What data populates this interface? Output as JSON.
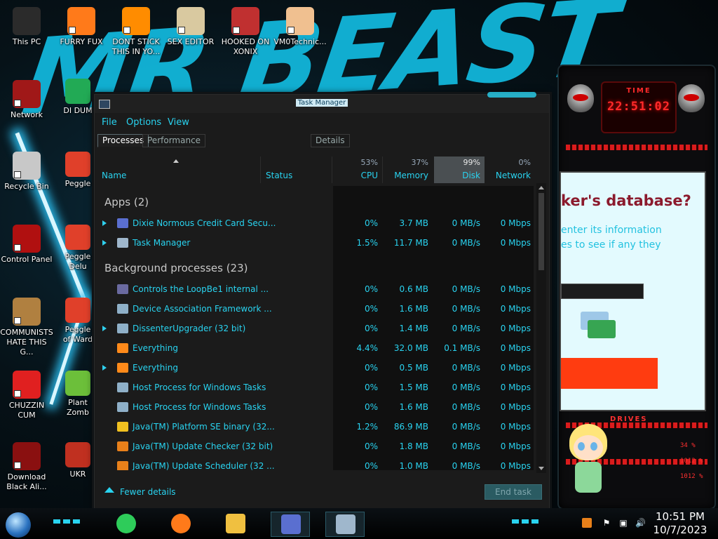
{
  "desktop": {
    "wallpaper_text": "MR BEAST",
    "icons": [
      {
        "label": "This PC",
        "icon": "computer-icon",
        "color": "#2b2b2b"
      },
      {
        "label": "FURRY FUX",
        "icon": "firefox-icon",
        "color": "#ff7a1a"
      },
      {
        "label": "DONT STICK THIS IN YO...",
        "icon": "vlc-cone-icon",
        "color": "#ff8c00"
      },
      {
        "label": "SEX EDITOR",
        "icon": "hxd-editor-icon",
        "color": "#d9c9a0"
      },
      {
        "label": "HOOKED ON XONIX",
        "icon": "xonix-game-icon",
        "color": "#c03030"
      },
      {
        "label": "VM0Technic...",
        "icon": "doctor-avatar-icon",
        "color": "#f0c090"
      },
      {
        "label": "Network",
        "icon": "network-icon",
        "color": "#a01818"
      },
      {
        "label": "Recycle Bin",
        "icon": "recycle-bin-icon",
        "color": "#c8c8c8"
      },
      {
        "label": "Control Panel",
        "icon": "control-panel-icon",
        "color": "#b01010"
      },
      {
        "label": "COMMUNISTS HATE THIS G...",
        "icon": "money-bag-icon",
        "color": "#b08040"
      },
      {
        "label": "CHUZZIN CUM",
        "icon": "chuzzle-icon",
        "color": "#e02020"
      },
      {
        "label": "Download Black Ali...",
        "icon": "alien-download-icon",
        "color": "#8a1010"
      }
    ],
    "partial_icons": [
      {
        "label": "DI DUM",
        "icon": "app-green-icon",
        "color": "#22aa55"
      },
      {
        "label": "Peggle",
        "icon": "peggle-icon",
        "color": "#e0402a"
      },
      {
        "label": "Peggle Delu",
        "icon": "peggle-deluxe-icon",
        "color": "#e0402a"
      },
      {
        "label": "Peggle of Ward",
        "icon": "peggle-nights-icon",
        "color": "#e0402a"
      },
      {
        "label": "Plant Zomb",
        "icon": "plants-zombies-icon",
        "color": "#6cbf3a"
      },
      {
        "label": "UKR",
        "icon": "app-red-icon",
        "color": "#c03020"
      }
    ]
  },
  "gadget": {
    "time_label": "TIME",
    "time": "22:51:02",
    "drives_label": "DRIVES",
    "drive_values": [
      "34 %",
      "1012 %",
      "1012 %"
    ],
    "browser_heading": "ker's database?",
    "browser_line1": "enter its information",
    "browser_line2": "es to see if any they"
  },
  "taskmanager": {
    "title": "Task Manager",
    "menu": [
      "File",
      "Options",
      "View"
    ],
    "tabs": [
      "Processes",
      "Performance",
      "Details"
    ],
    "columns": {
      "name": "Name",
      "status": "Status",
      "cpu_pct": "53%",
      "cpu": "CPU",
      "mem_pct": "37%",
      "mem": "Memory",
      "disk_pct": "99%",
      "disk": "Disk",
      "net_pct": "0%",
      "net": "Network"
    },
    "apps_group": "Apps (2)",
    "apps": [
      {
        "name": "Dixie Normous Credit Card Secu...",
        "cpu": "0%",
        "mem": "3.7 MB",
        "disk": "0 MB/s",
        "net": "0 Mbps",
        "icon": "credit-card-app-icon",
        "color": "#5a6fd0",
        "expand": true
      },
      {
        "name": "Task Manager",
        "cpu": "1.5%",
        "mem": "11.7 MB",
        "disk": "0 MB/s",
        "net": "0 Mbps",
        "icon": "task-manager-icon",
        "color": "#9fb7cc",
        "expand": true
      }
    ],
    "bg_group": "Background processes (23)",
    "background": [
      {
        "name": "Controls the LoopBe1 internal ...",
        "cpu": "0%",
        "mem": "0.6 MB",
        "disk": "0 MB/s",
        "net": "0 Mbps",
        "icon": "loopbe-icon",
        "color": "#6a6aa0",
        "expand": false
      },
      {
        "name": "Device Association Framework ...",
        "cpu": "0%",
        "mem": "1.6 MB",
        "disk": "0 MB/s",
        "net": "0 Mbps",
        "icon": "service-window-icon",
        "color": "#8fb0c8",
        "expand": false
      },
      {
        "name": "DissenterUpgrader (32 bit)",
        "cpu": "0%",
        "mem": "1.4 MB",
        "disk": "0 MB/s",
        "net": "0 Mbps",
        "icon": "service-window-icon",
        "color": "#8fb0c8",
        "expand": true
      },
      {
        "name": "Everything",
        "cpu": "4.4%",
        "mem": "32.0 MB",
        "disk": "0.1 MB/s",
        "net": "0 Mbps",
        "icon": "magnifier-icon",
        "color": "#ff8a1a",
        "expand": false
      },
      {
        "name": "Everything",
        "cpu": "0%",
        "mem": "0.5 MB",
        "disk": "0 MB/s",
        "net": "0 Mbps",
        "icon": "magnifier-icon",
        "color": "#ff8a1a",
        "expand": true
      },
      {
        "name": "Host Process for Windows Tasks",
        "cpu": "0%",
        "mem": "1.5 MB",
        "disk": "0 MB/s",
        "net": "0 Mbps",
        "icon": "service-window-icon",
        "color": "#8fb0c8",
        "expand": false
      },
      {
        "name": "Host Process for Windows Tasks",
        "cpu": "0%",
        "mem": "1.6 MB",
        "disk": "0 MB/s",
        "net": "0 Mbps",
        "icon": "service-window-icon",
        "color": "#8fb0c8",
        "expand": false
      },
      {
        "name": "Java(TM) Platform SE binary (32...",
        "cpu": "1.2%",
        "mem": "86.9 MB",
        "disk": "0 MB/s",
        "net": "0 Mbps",
        "icon": "star-icon",
        "color": "#f0c020",
        "expand": false
      },
      {
        "name": "Java(TM) Update Checker (32 bit)",
        "cpu": "0%",
        "mem": "1.8 MB",
        "disk": "0 MB/s",
        "net": "0 Mbps",
        "icon": "java-icon",
        "color": "#e8801a",
        "expand": false
      },
      {
        "name": "Java(TM) Update Scheduler (32 ...",
        "cpu": "0%",
        "mem": "1.0 MB",
        "disk": "0 MB/s",
        "net": "0 Mbps",
        "icon": "java-icon",
        "color": "#e8801a",
        "expand": false
      }
    ],
    "fewer_details": "Fewer details",
    "end_task": "End task"
  },
  "taskbar": {
    "pinned": [
      {
        "icon": "green-chat-app-icon",
        "color": "#2ecc5a"
      },
      {
        "icon": "firefox-icon",
        "color": "#ff7a1a"
      },
      {
        "icon": "file-explorer-icon",
        "color": "#f0c040"
      },
      {
        "icon": "credit-card-app-icon",
        "color": "#5a6fd0"
      },
      {
        "icon": "task-manager-icon",
        "color": "#9fb7cc"
      }
    ],
    "time": "10:51 PM",
    "date": "10/7/2023"
  }
}
